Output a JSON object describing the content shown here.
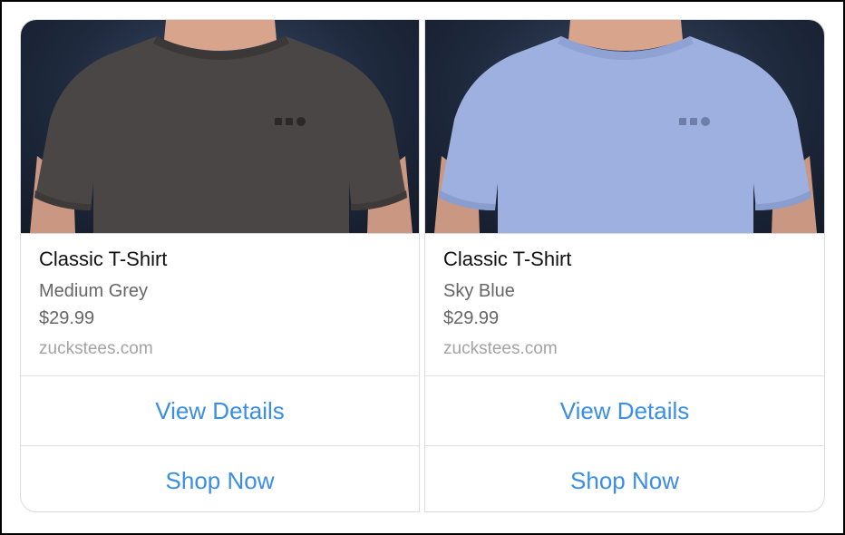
{
  "products": [
    {
      "title": "Classic T-Shirt",
      "variant": "Medium Grey",
      "price": "$29.99",
      "domain": "zuckstees.com",
      "shirt_color": "#4a4645",
      "view_details_label": "View Details",
      "shop_now_label": "Shop Now"
    },
    {
      "title": "Classic T-Shirt",
      "variant": "Sky Blue",
      "price": "$29.99",
      "domain": "zuckstees.com",
      "shirt_color": "#9db0df",
      "view_details_label": "View Details",
      "shop_now_label": "Shop Now"
    }
  ],
  "colors": {
    "link": "#3a8ee6",
    "photo_background": "#1f2a3e",
    "skin": "#d9a48c"
  }
}
